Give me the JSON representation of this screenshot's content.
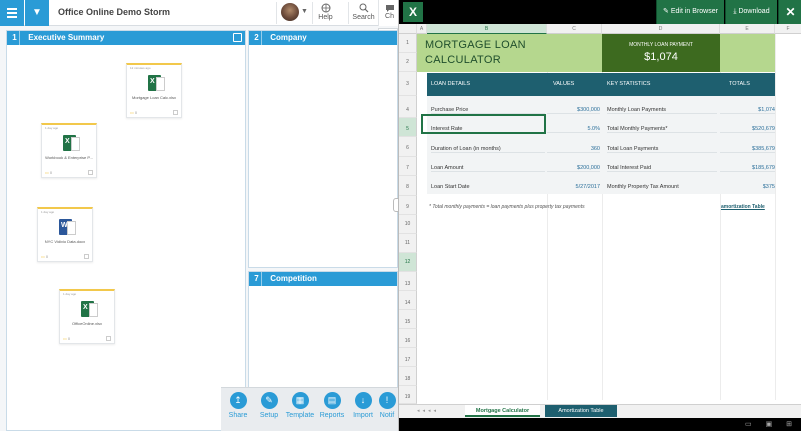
{
  "app": {
    "title": "Office Online Demo Storm",
    "tools": [
      {
        "label": "Help",
        "icon": "help-globe-icon"
      },
      {
        "label": "Search",
        "icon": "search-icon"
      },
      {
        "label": "Ch",
        "icon": "chat-icon"
      }
    ]
  },
  "lanes": [
    {
      "num": "1",
      "title": "Executive Summary"
    },
    {
      "num": "2",
      "title": "Company"
    },
    {
      "num": "7",
      "title": "Competition"
    }
  ],
  "cards": [
    {
      "meta": "12 minutes ago",
      "name": "Mortgage Loan Calc.xlsx",
      "type": "xlsx",
      "count": "0"
    },
    {
      "meta": "1 day ago",
      "name": "Workbook & Enterprise P...",
      "type": "xlsx",
      "count": "0"
    },
    {
      "meta": "1 day ago",
      "name": "NYC Vidivio Data.docx",
      "type": "docx",
      "count": "0"
    },
    {
      "meta": "1 day ago",
      "name": "OfficeOnline.xlsx",
      "type": "xlsx",
      "count": "0"
    }
  ],
  "dock": [
    {
      "label": "Share",
      "icon": "share-icon"
    },
    {
      "label": "Setup",
      "icon": "setup-icon"
    },
    {
      "label": "Template",
      "icon": "template-icon"
    },
    {
      "label": "Reports",
      "icon": "reports-icon"
    },
    {
      "label": "Import",
      "icon": "import-icon"
    },
    {
      "label": "Notif",
      "icon": "notification-icon"
    }
  ],
  "excel": {
    "logo": "X",
    "edit_label": "Edit in Browser",
    "download_label": "Download",
    "close_label": "✕",
    "columns": [
      "A",
      "B",
      "C",
      "D",
      "E",
      "F"
    ],
    "rows": [
      "1",
      "2",
      "3",
      "4",
      "5",
      "6",
      "7",
      "8",
      "9",
      "10",
      "11",
      "12",
      "13",
      "14",
      "15",
      "16",
      "17",
      "18",
      "19"
    ],
    "title_line1": "MORTGAGE LOAN",
    "title_line2": "CALCULATOR",
    "payment_label": "MONTHLY LOAN PAYMENT",
    "payment_value": "$1,074",
    "headers": {
      "details": "LOAN DETAILS",
      "values": "VALUES",
      "stats": "KEY STATISTICS",
      "totals": "TOTALS"
    },
    "loan_rows": [
      {
        "label": "Purchase Price",
        "value": "$300,000",
        "stat": "Monthly Loan Payments",
        "total": "$1,074"
      },
      {
        "label": "Interest Rate",
        "value": "5.0%",
        "stat": "Total Monthly Payments*",
        "total": "$520,679"
      },
      {
        "label": "Duration of Loan (in months)",
        "value": "360",
        "stat": "Total Loan Payments",
        "total": "$385,679"
      },
      {
        "label": "Loan Amount",
        "value": "$200,000",
        "stat": "Total Interest Paid",
        "total": "$185,679"
      },
      {
        "label": "Loan Start Date",
        "value": "5/27/2017",
        "stat": "Monthly Property Tax Amount",
        "total": "$375"
      }
    ],
    "footnote": "* Total monthly payments = loan payments plus property tax payments",
    "amort_link": "amortization Table",
    "tabs": [
      "Mortgage Calculator",
      "Amortization Table"
    ],
    "status_icons": "▭ ▣ ⊞"
  }
}
